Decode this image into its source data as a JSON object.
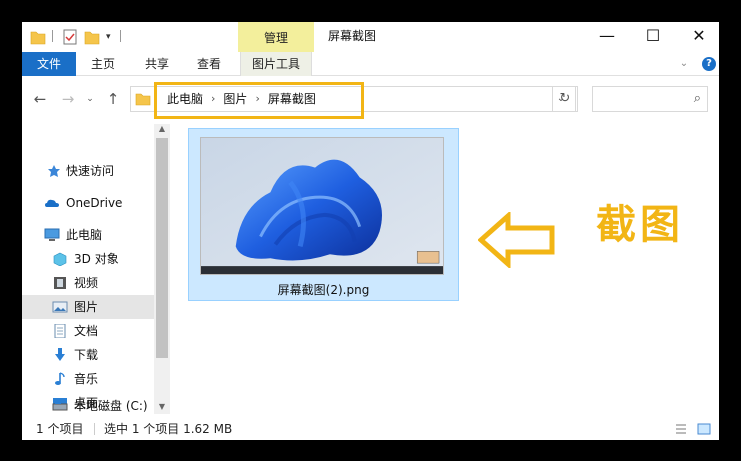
{
  "titlebar": {
    "manage_tab": "管理",
    "title": "屏幕截图",
    "minimize": "—",
    "maximize": "☐",
    "close": "✕"
  },
  "ribbon": {
    "file": "文件",
    "home": "主页",
    "share": "共享",
    "view": "查看",
    "picture_tools": "图片工具",
    "help": "?"
  },
  "address": {
    "crumbs": [
      "此电脑",
      "图片",
      "屏幕截图"
    ]
  },
  "navpane": {
    "items": [
      {
        "label": "快速访问",
        "icon": "star-icon"
      },
      {
        "label": "OneDrive",
        "icon": "cloud-icon"
      },
      {
        "label": "此电脑",
        "icon": "computer-icon"
      },
      {
        "label": "3D 对象",
        "icon": "cube-icon"
      },
      {
        "label": "视频",
        "icon": "video-icon"
      },
      {
        "label": "图片",
        "icon": "picture-icon"
      },
      {
        "label": "文档",
        "icon": "document-icon"
      },
      {
        "label": "下载",
        "icon": "download-icon"
      },
      {
        "label": "音乐",
        "icon": "music-icon"
      },
      {
        "label": "桌面",
        "icon": "desktop-icon"
      },
      {
        "label": "本地磁盘 (C:)",
        "icon": "drive-icon"
      }
    ]
  },
  "content": {
    "file_name": "屏幕截图(2).png",
    "callout": "截图"
  },
  "status": {
    "count": "1 个项目",
    "selected": "选中 1 个项目  1.62 MB"
  },
  "colors": {
    "accent": "#1a6fc7",
    "highlight": "#f2b515",
    "manage_tab": "#f3ef9c",
    "selection": "#cce8ff"
  }
}
